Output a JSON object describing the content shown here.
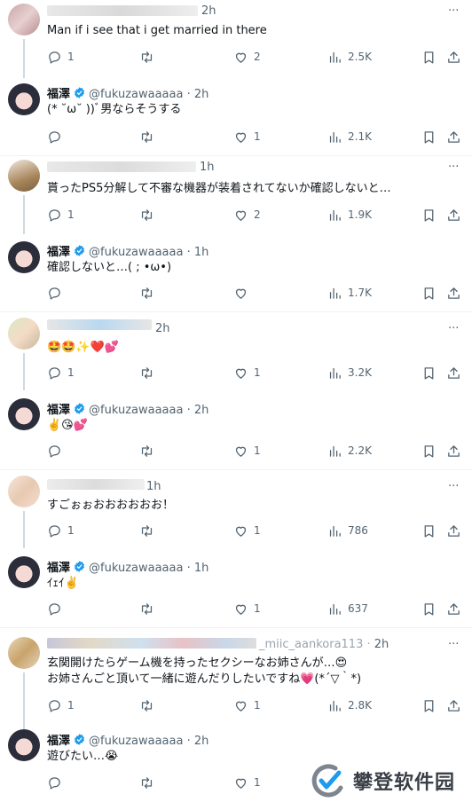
{
  "reply_handle": "@fukuzawaaaaa",
  "reply_name": "福澤",
  "tweets": [
    {
      "reply": {
        "time": "2h",
        "text": "Man if i see that i get married in there",
        "replies": "1",
        "reposts": "",
        "likes": "2",
        "views": "2.5K"
      },
      "answer": {
        "time": "2h",
        "text": "(* ˘ω˘ ))ﾞ男ならそうする",
        "replies": "",
        "reposts": "",
        "likes": "1",
        "views": "2.1K"
      }
    },
    {
      "reply": {
        "time": "1h",
        "text": "貰ったPS5分解して不審な機器が装着されてないか確認しないと…",
        "replies": "1",
        "reposts": "",
        "likes": "2",
        "views": "1.9K"
      },
      "answer": {
        "time": "1h",
        "text": "確認しないと…( ; •ω•)",
        "replies": "",
        "reposts": "",
        "likes": "",
        "views": "1.7K"
      }
    },
    {
      "reply": {
        "time": "2h",
        "text": "🤩🤩✨❤️💕",
        "replies": "1",
        "reposts": "",
        "likes": "1",
        "views": "3.2K"
      },
      "answer": {
        "time": "2h",
        "text": "✌️😘💕",
        "replies": "",
        "reposts": "",
        "likes": "1",
        "views": "2.2K"
      }
    },
    {
      "reply": {
        "time": "1h",
        "text": "すごぉぉおおおおおお！",
        "replies": "1",
        "reposts": "",
        "likes": "1",
        "views": "786"
      },
      "answer": {
        "time": "1h",
        "text": "ｲｪｲ✌️",
        "replies": "",
        "reposts": "",
        "likes": "1",
        "views": "637"
      }
    },
    {
      "reply": {
        "time": "2h",
        "handle_fragment": "_miic_aankora113 ·",
        "text": "玄関開けたらゲーム機を持ったセクシーなお姉さんが…😍",
        "text2": "お姉さんごと頂いて一緒に遊んだりしたいですね💗(*´▽｀*)",
        "replies": "1",
        "reposts": "",
        "likes": "1",
        "views": "2.8K"
      },
      "answer": {
        "time": "2h",
        "text": "遊びたい…😭",
        "replies": "",
        "reposts": "",
        "likes": "1",
        "views": ""
      }
    }
  ],
  "watermark": {
    "text": "攀登软件园"
  },
  "colors": {
    "accent": "#1d9bf0",
    "muted": "#536471",
    "separator": "#eff3f4",
    "thread": "#cfd9de"
  }
}
